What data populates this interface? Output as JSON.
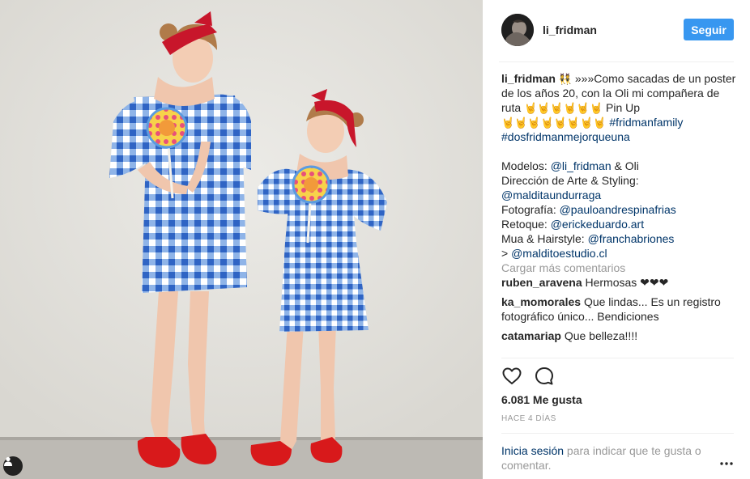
{
  "post": {
    "author": "li_fridman",
    "follow_label": "Seguir"
  },
  "caption": {
    "author": "li_fridman",
    "emoji1": "👯",
    "text1": " »»»Como sacadas de un poster de los años 20, con la Oli mi compañera de ruta ",
    "rock_emojis1": "🤘🤘🤘🤘🤘🤘",
    "text2": " Pin Up ",
    "rock_emojis2": "🤘🤘🤘🤘🤘🤘🤘🤘",
    "hashtag1": "#fridmanfamily",
    "hashtag2": "#dosfridmanmejorqueuna",
    "modelos_label": "Modelos: ",
    "modelos_mention": "@li_fridman",
    "modelos_rest": " & Oli",
    "direccion_label": "Dirección de Arte & Styling:",
    "direccion_mention": "@malditaundurraga",
    "foto_label": "Fotografía: ",
    "foto_mention": "@pauloandrespinafrias",
    "retoque_label": "Retoque: ",
    "retoque_mention": "@erickeduardo.art",
    "mua_label": "Mua & Hairstyle: ",
    "mua_mention": "@franchabriones",
    "arrow": "> ",
    "studio_mention": "@malditoestudio.cl"
  },
  "load_more": "Cargar más comentarios",
  "comments": [
    {
      "user": "ruben_aravena",
      "text": " Hermosas ❤❤❤"
    },
    {
      "user": "ka_momorales",
      "text": " Que lindas... Es un registro fotográfico único... Bendiciones"
    },
    {
      "user": "catamariap",
      "text": " Que belleza!!!!"
    }
  ],
  "likes": "6.081 Me gusta",
  "time_ago": "HACE 4 DÍAS",
  "login_prompt": {
    "link": "Inicia sesión",
    "rest": " para indicar que te gusta o comentar."
  },
  "icons": {
    "like": "heart-icon",
    "comment": "comment-icon",
    "more": "more-options-icon",
    "user_tag": "user-tag-icon"
  },
  "colors": {
    "follow_button": "#3897f0",
    "link": "#003569",
    "muted": "#999999",
    "dress_blue": "#3a6fc9",
    "shoes_red": "#d8191b"
  }
}
